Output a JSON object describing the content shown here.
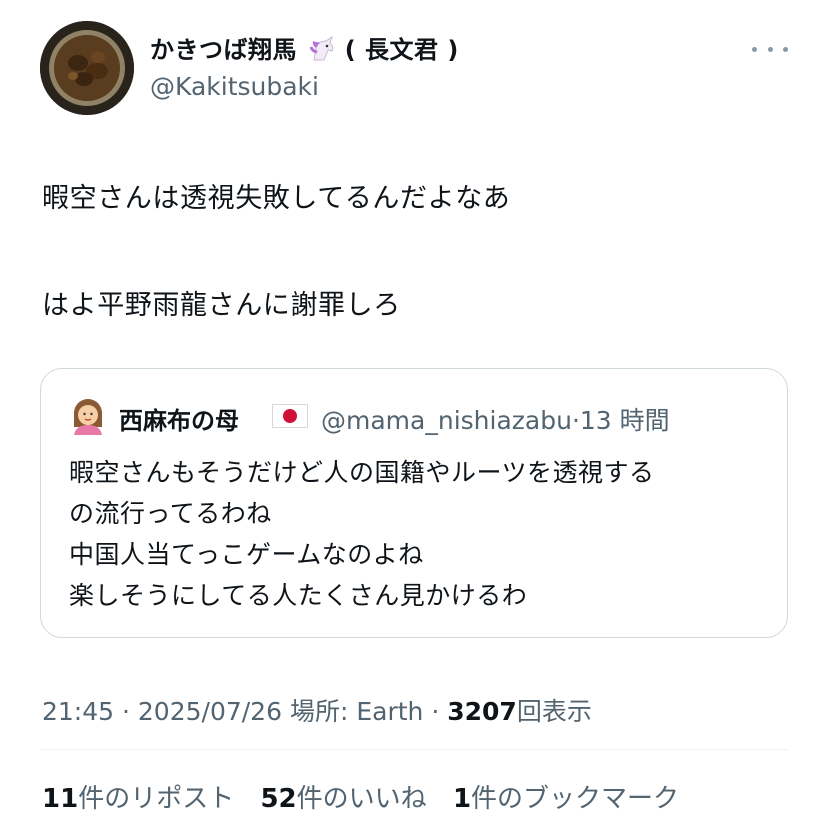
{
  "author": {
    "name": "かきつば翔馬",
    "name_suffix": "( 長文君 )",
    "name_emoji": "🦄",
    "handle": "@Kakitsubaki"
  },
  "tweet": {
    "lines": [
      "暇空さんは透視失敗してるんだよなあ",
      "はよ平野雨龍さんに謝罪しろ"
    ]
  },
  "quote": {
    "name": "西麻布の母",
    "handle": "@mama_nishiazabu",
    "separator": "·",
    "time": "13 時間",
    "lines": [
      "暇空さんもそうだけど人の国籍やルーツを透視する",
      "の流行ってるわね",
      "中国人当てっこゲームなのよね",
      "楽しそうにしてる人たくさん見かけるわ"
    ]
  },
  "meta": {
    "time": "21:45",
    "date": "2025/07/26",
    "location": "場所: Earth",
    "separator": "·",
    "views_count": "3207",
    "views_label": "回表示"
  },
  "stats": {
    "reposts_count": "11",
    "reposts_label": "件のリポスト",
    "likes_count": "52",
    "likes_label": "件のいいね",
    "bookmarks_count": "1",
    "bookmarks_label": "件のブックマーク"
  },
  "colors": {
    "text": "#0f1419",
    "secondary": "#536471",
    "border": "#cfd9de",
    "divider": "#eff3f4",
    "flag_red": "#d0103a"
  },
  "icons": {
    "more": "more-horizontal-icon",
    "unicorn": "unicorn-emoji",
    "flag": "japan-flag-icon",
    "quote_avatar": "woman-avatar-icon"
  }
}
